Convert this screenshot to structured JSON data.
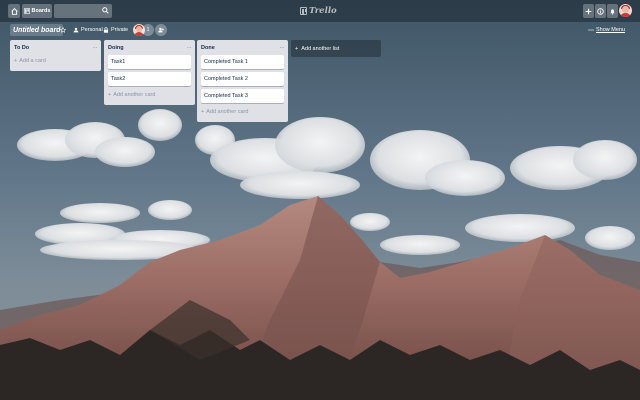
{
  "header": {
    "boards_label": "Boards",
    "logo_text": "Trello"
  },
  "board": {
    "title": "Untitled board",
    "team_label": "Personal",
    "visibility_label": "Private",
    "member_count": "1",
    "show_menu_label": "Show Menu"
  },
  "lists": [
    {
      "title": "To Do",
      "cards": [],
      "add_card_label": "Add a card"
    },
    {
      "title": "Doing",
      "cards": [
        "Task1",
        "Task2"
      ],
      "add_card_label": "Add another card"
    },
    {
      "title": "Done",
      "cards": [
        "Completed Task 1",
        "Completed Task 2",
        "Completed Task 3"
      ],
      "add_card_label": "Add another card"
    }
  ],
  "add_list_label": "Add another list",
  "icons": [
    "home-icon",
    "boards-icon",
    "search-icon",
    "trello-logo-icon",
    "plus-icon",
    "info-icon",
    "bell-icon",
    "star-icon",
    "team-icon",
    "lock-icon",
    "invite-icon",
    "more-icon"
  ],
  "colors": {
    "list_bg": "#dfe1e6",
    "card_bg": "#ffffff",
    "text": "#172b4d",
    "header_bg": "#1e2832"
  }
}
